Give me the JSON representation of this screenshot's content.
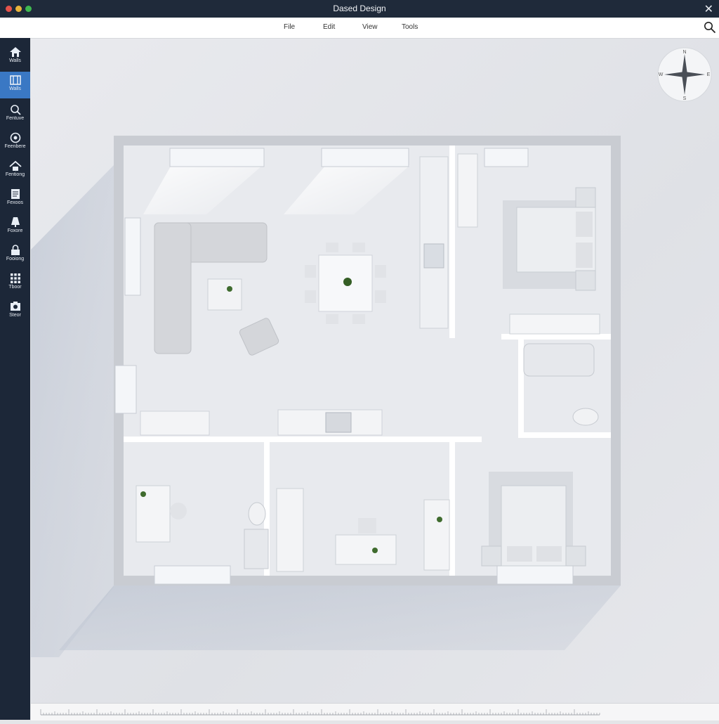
{
  "window": {
    "title": "Dased Design",
    "close_glyph": "✕"
  },
  "menu": {
    "items": [
      "File",
      "Edit",
      "View",
      "Tools"
    ]
  },
  "search": {
    "icon": "search-icon"
  },
  "sidebar": {
    "active_index": 1,
    "accent": "#3a78c4",
    "items": [
      {
        "label": "Walls",
        "icon": "house-icon"
      },
      {
        "label": "Walls",
        "icon": "wall-icon"
      },
      {
        "label": "Fentuve",
        "icon": "magnifier-icon"
      },
      {
        "label": "Feenbere",
        "icon": "target-icon"
      },
      {
        "label": "Fentiong",
        "icon": "roof-icon"
      },
      {
        "label": "Fexoos",
        "icon": "document-icon"
      },
      {
        "label": "Foxore",
        "icon": "lamp-icon"
      },
      {
        "label": "Fooiong",
        "icon": "lock-icon"
      },
      {
        "label": "Tboor",
        "icon": "grid-icon"
      },
      {
        "label": "Steor",
        "icon": "camera-icon"
      }
    ]
  },
  "compass": {
    "n": "N",
    "s": "S",
    "e": "E",
    "w": "W"
  },
  "colors": {
    "titlebar": "#1f2a3a",
    "sidebar": "#1c2738",
    "canvas": "#e4e5e8",
    "wall": "#ffffff",
    "floor": "#e6e8ec"
  }
}
